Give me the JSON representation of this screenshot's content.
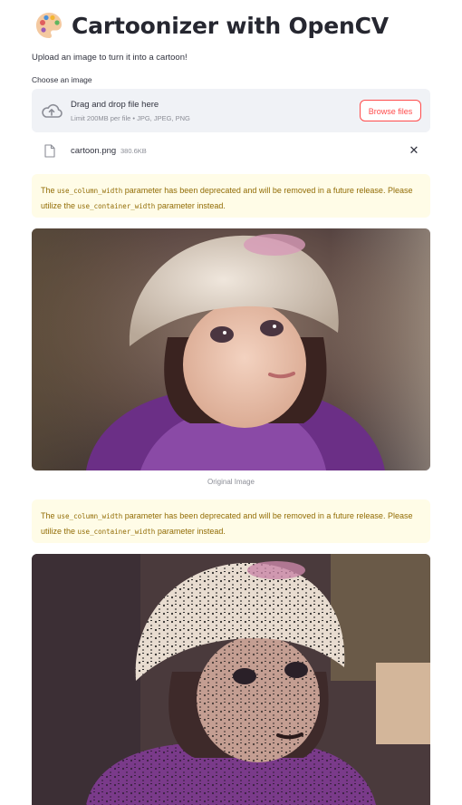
{
  "header": {
    "title": "Cartoonizer with OpenCV",
    "icon": "palette-icon"
  },
  "subtitle": "Upload an image to turn it into a cartoon!",
  "uploader": {
    "label": "Choose an image",
    "drop_text": "Drag and drop file here",
    "limit_text": "Limit 200MB per file • JPG, JPEG, PNG",
    "browse_label": "Browse files",
    "file": {
      "name": "cartoon.png",
      "size": "380.6KB"
    }
  },
  "alerts": [
    {
      "part1": "The ",
      "code1": "use_column_width",
      "part2": " parameter has been deprecated and will be removed in a future release. Please utilize the ",
      "code2": "use_container_width",
      "part3": " parameter instead."
    },
    {
      "part1": "The ",
      "code1": "use_column_width",
      "part2": " parameter has been deprecated and will be removed in a future release. Please utilize the ",
      "code2": "use_container_width",
      "part3": " parameter instead."
    }
  ],
  "images": {
    "original_caption": "Original Image"
  },
  "colors": {
    "accent": "#ff4b4b",
    "warning_bg": "#fffce7",
    "warning_text": "#926c05",
    "dropzone_bg": "#f0f2f6"
  }
}
